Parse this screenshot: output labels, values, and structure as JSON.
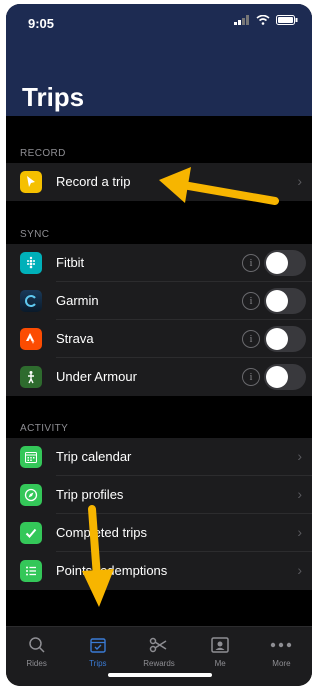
{
  "status": {
    "time": "9:05"
  },
  "header": {
    "title": "Trips"
  },
  "sections": {
    "record": "RECORD",
    "sync": "SYNC",
    "activity": "ACTIVITY"
  },
  "record_items": [
    {
      "label": "Record a trip",
      "icon": "cursor-icon"
    }
  ],
  "sync_items": [
    {
      "label": "Fitbit",
      "icon": "fitbit-icon"
    },
    {
      "label": "Garmin",
      "icon": "garmin-icon"
    },
    {
      "label": "Strava",
      "icon": "strava-icon"
    },
    {
      "label": "Under Armour",
      "icon": "under-armour-icon"
    }
  ],
  "activity_items": [
    {
      "label": "Trip calendar",
      "icon": "calendar-icon"
    },
    {
      "label": "Trip profiles",
      "icon": "compass-icon"
    },
    {
      "label": "Completed trips",
      "icon": "checkmark-icon"
    },
    {
      "label": "Points redemptions",
      "icon": "list-icon"
    }
  ],
  "tabs": [
    {
      "label": "Rides",
      "icon": "search-icon"
    },
    {
      "label": "Trips",
      "icon": "calendar-check-icon",
      "active": true
    },
    {
      "label": "Rewards",
      "icon": "scissors-icon"
    },
    {
      "label": "Me",
      "icon": "profile-icon"
    },
    {
      "label": "More",
      "icon": "more-icon"
    }
  ],
  "colors": {
    "header": "#1d2b52",
    "accent": "#3a7bd5",
    "arrow": "#f7b500"
  }
}
